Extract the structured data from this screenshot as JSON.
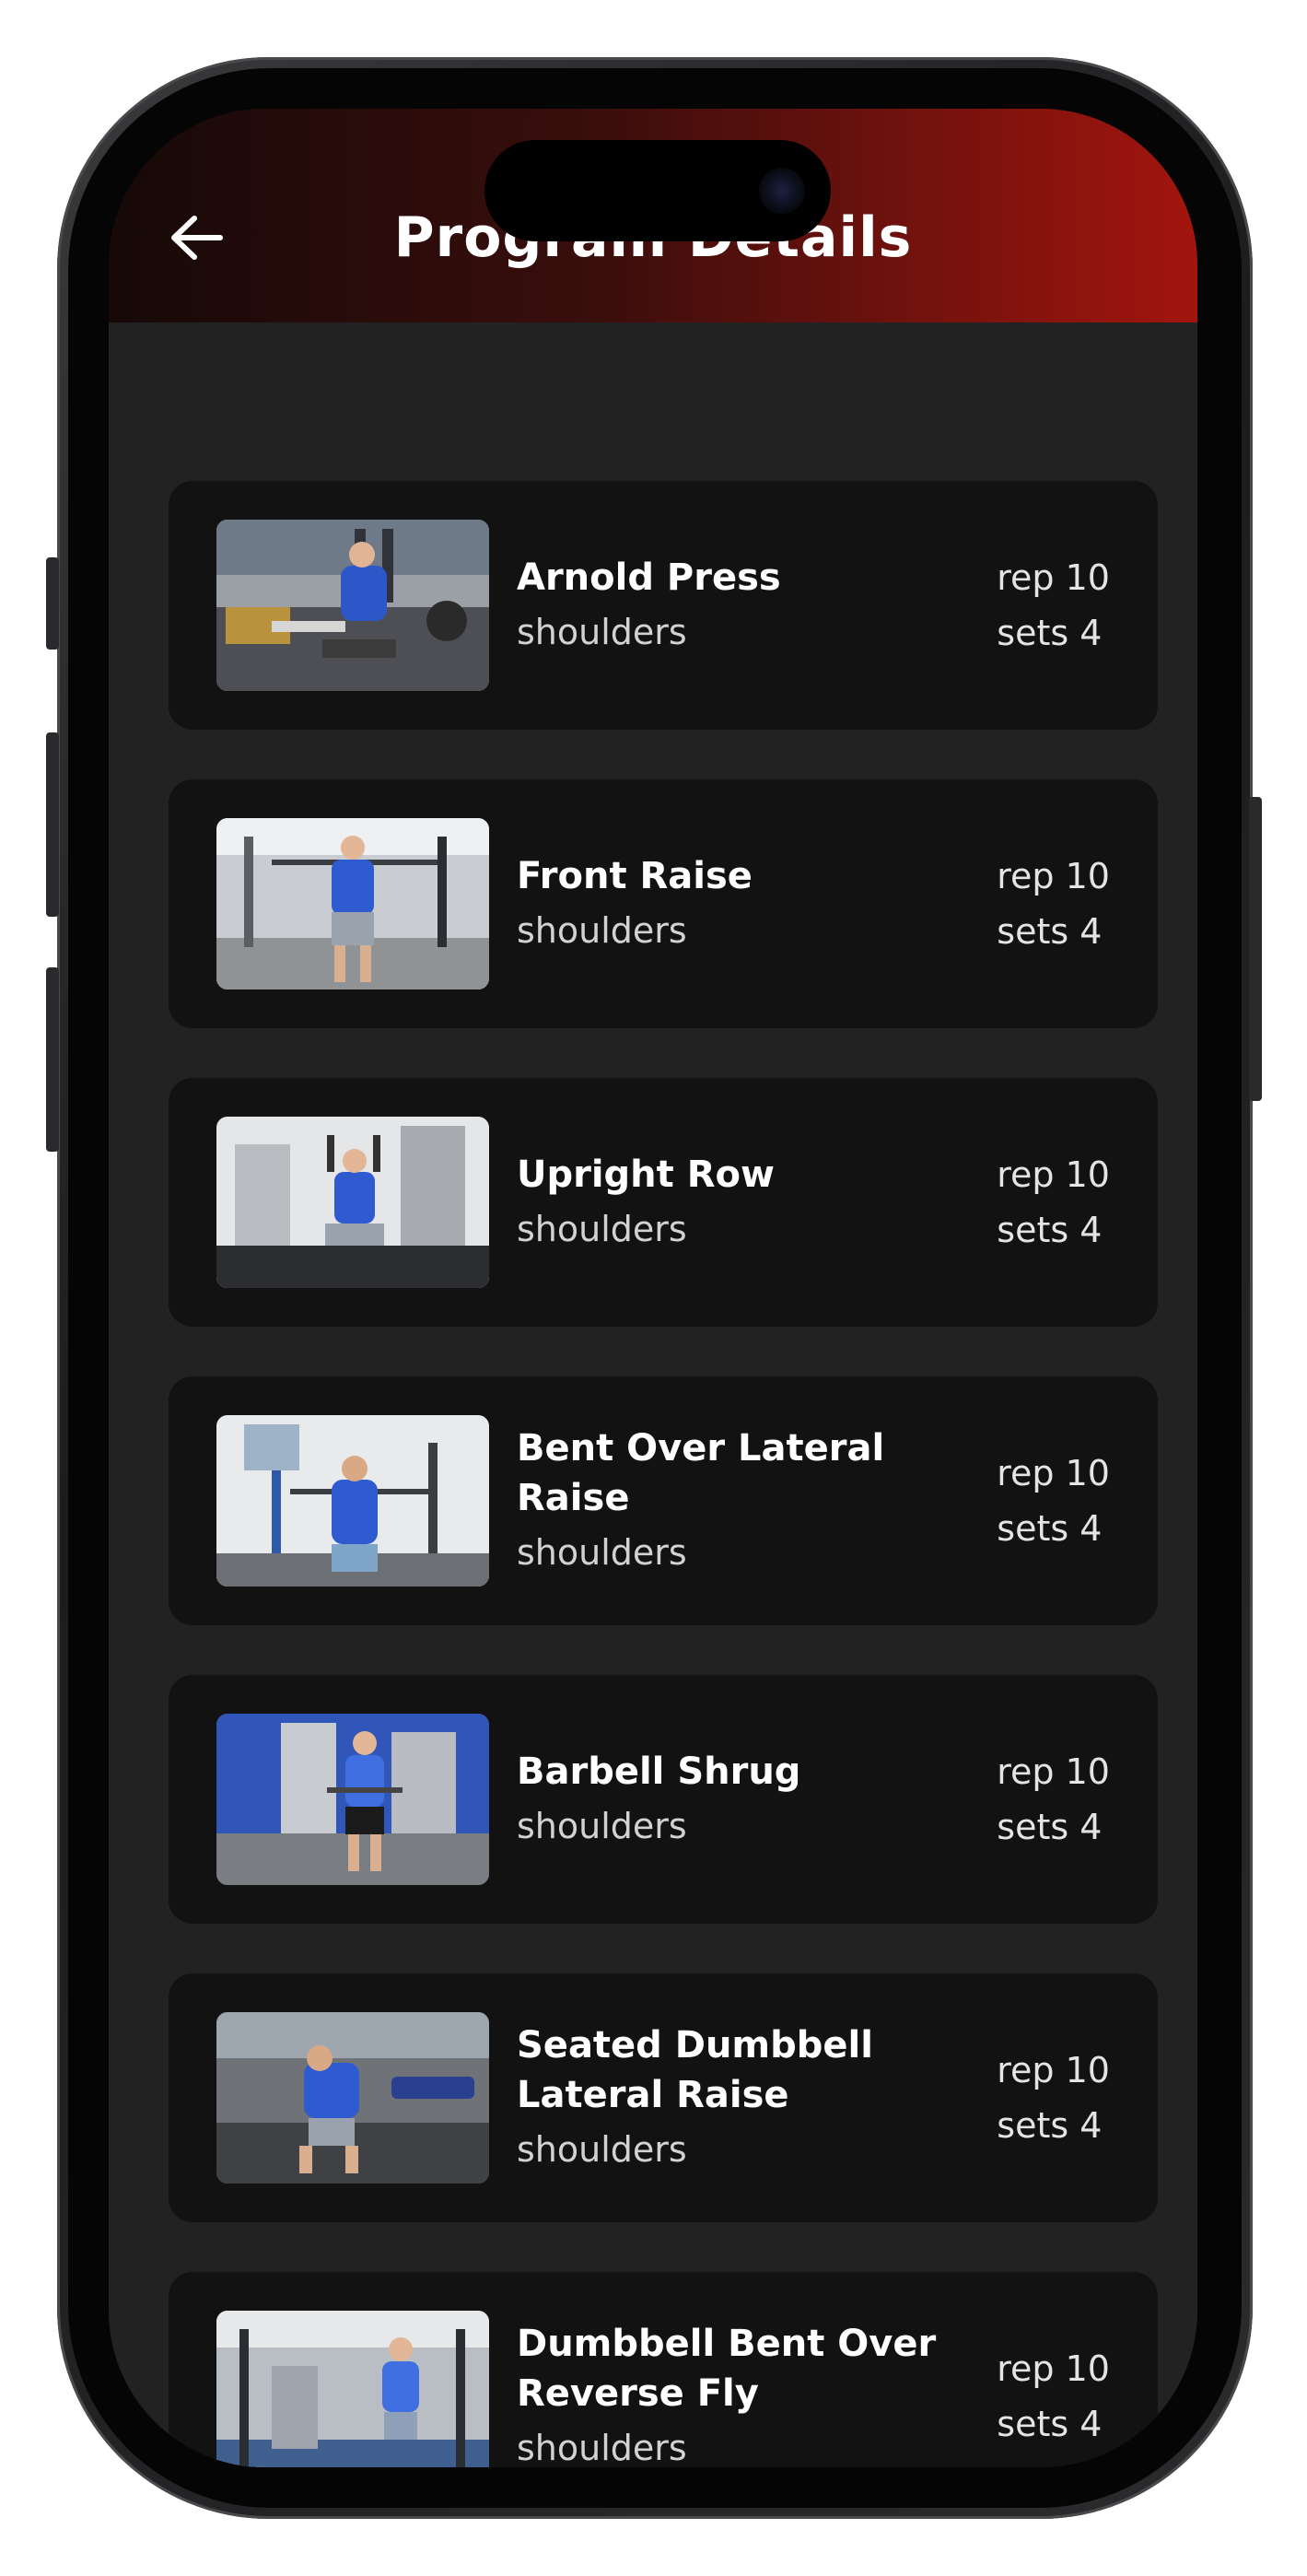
{
  "header": {
    "title": "Program Details",
    "back_icon": "arrow-left-icon"
  },
  "colors": {
    "header_gradient_start": "#160908",
    "header_gradient_end": "#a3150e",
    "background": "#222222",
    "card": "#121212",
    "text_primary": "#ffffff",
    "text_secondary": "#d2d2d2"
  },
  "exercises": [
    {
      "name": "Arnold Press",
      "group": "shoulders",
      "rep": "rep 10",
      "sets": "sets 4"
    },
    {
      "name": "Front Raise",
      "group": "shoulders",
      "rep": "rep 10",
      "sets": "sets 4"
    },
    {
      "name": "Upright Row",
      "group": "shoulders",
      "rep": "rep 10",
      "sets": "sets 4"
    },
    {
      "name": "Bent Over Lateral Raise",
      "group": "shoulders",
      "rep": "rep 10",
      "sets": "sets 4"
    },
    {
      "name": "Barbell Shrug",
      "group": "shoulders",
      "rep": "rep 10",
      "sets": "sets 4"
    },
    {
      "name": "Seated Dumbbell Lateral Raise",
      "group": "shoulders",
      "rep": "rep 10",
      "sets": "sets 4"
    },
    {
      "name": "Dumbbell Bent Over Reverse Fly",
      "group": "shoulders",
      "rep": "rep 10",
      "sets": "sets 4"
    }
  ]
}
